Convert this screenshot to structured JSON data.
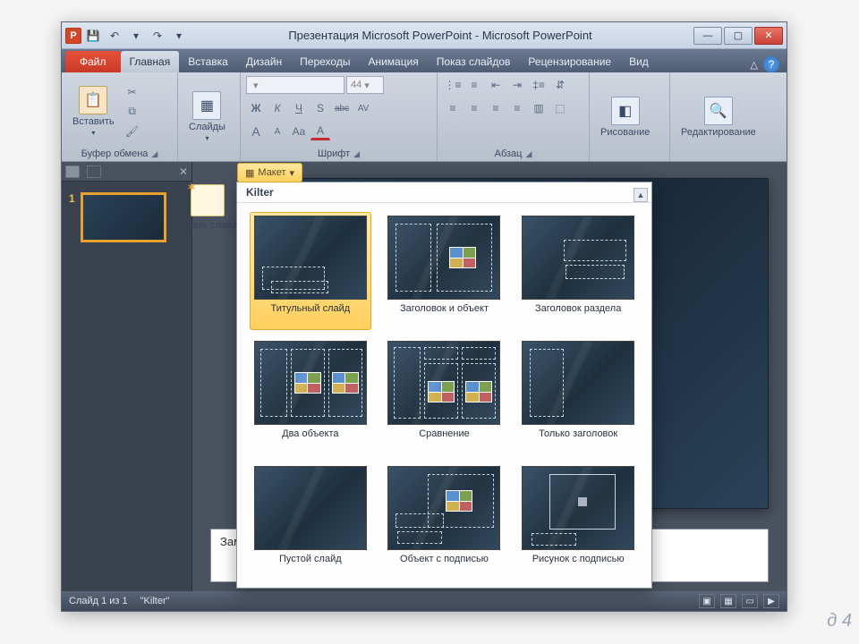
{
  "window": {
    "title": "Презентация Microsoft PowerPoint  -  Microsoft PowerPoint",
    "app_icon_text": "P"
  },
  "qat": {
    "save": "💾",
    "undo": "↶",
    "redo": "↷",
    "dropdown": "▾"
  },
  "tabs": {
    "file": "Файл",
    "items": [
      "Главная",
      "Вставка",
      "Дизайн",
      "Переходы",
      "Анимация",
      "Показ слайдов",
      "Рецензирование",
      "Вид"
    ],
    "active_index": 0
  },
  "ribbon": {
    "clipboard": {
      "paste": "Вставить",
      "label": "Буфер обмена"
    },
    "slides": {
      "label": "Слайды"
    },
    "font": {
      "name_placeholder": "",
      "size_placeholder": "44",
      "bold": "Ж",
      "italic": "К",
      "underline": "Ч",
      "shadow": "S",
      "strike": "abc",
      "spacing": "AV",
      "grow": "A",
      "shrink": "A",
      "clear": "Aa",
      "color": "A",
      "label": "Шрифт"
    },
    "paragraph": {
      "label": "Абзац"
    },
    "drawing": {
      "label": "Рисование"
    },
    "editing": {
      "label": "Редактирование"
    }
  },
  "slide_panel": {
    "slide_number": "1"
  },
  "notes": {
    "placeholder": "Замет"
  },
  "status": {
    "slide_counter": "Слайд 1 из 1",
    "theme": "\"Kilter\""
  },
  "new_slide": {
    "label": "Создать слайд"
  },
  "layout": {
    "button": "Макет",
    "theme_header": "Kilter",
    "items": [
      {
        "id": "title",
        "label": "Титульный слайд"
      },
      {
        "id": "title-content",
        "label": "Заголовок и объект"
      },
      {
        "id": "section",
        "label": "Заголовок раздела"
      },
      {
        "id": "two-content",
        "label": "Два объекта"
      },
      {
        "id": "comparison",
        "label": "Сравнение"
      },
      {
        "id": "title-only",
        "label": "Только заголовок"
      },
      {
        "id": "blank",
        "label": "Пустой слайд"
      },
      {
        "id": "content-caption",
        "label": "Объект с подписью"
      },
      {
        "id": "picture-caption",
        "label": "Рисунок с подписью"
      }
    ],
    "selected_index": 0
  },
  "page_corner": "д 4"
}
